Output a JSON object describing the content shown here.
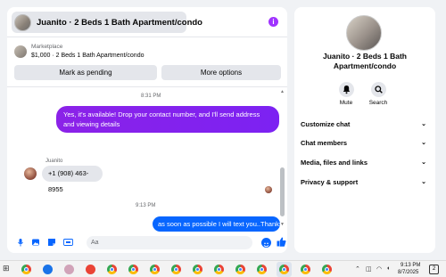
{
  "chat": {
    "title": "Juanito · 2 Beds 1 Bath Apartment/condo",
    "marketplace_label": "Marketplace",
    "listing": "$1,000 · 2 Beds 1 Bath Apartment/condo",
    "mark_pending": "Mark as pending",
    "more_options": "More options",
    "messages": {
      "time1": "8:31 PM",
      "outgoing1": "Yes, it's available! Drop your contact number, and I'll send address and viewing details",
      "sender": "Juanito",
      "incoming1": "+1 (908) 463-8955",
      "time2": "9:13 PM",
      "outgoing2": "as soon as possible I will text you..Thanks"
    },
    "composer_placeholder": "Aa"
  },
  "info": {
    "name": "Juanito · 2 Beds 1 Bath Apartment/condo",
    "mute_label": "Mute",
    "search_label": "Search",
    "menu": [
      "Customize chat",
      "Chat members",
      "Media, files and links",
      "Privacy & support"
    ]
  },
  "taskbar": {
    "time": "9:13 PM",
    "date": "8/7/2025",
    "notification_count": "2"
  },
  "colors": {
    "purple_bubble": "#8b22e8",
    "blue_bubble": "#0866ff",
    "info_icon": "#a033ff"
  }
}
